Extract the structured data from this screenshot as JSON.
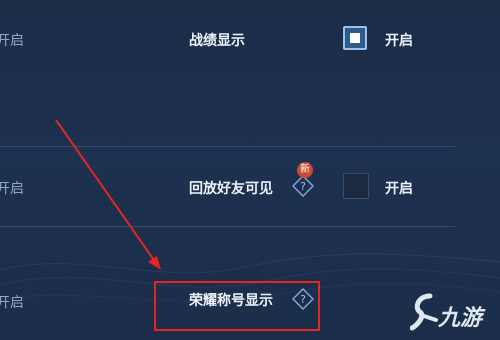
{
  "settings": {
    "rows": [
      {
        "label": "战绩显示",
        "state_label": "开启",
        "left_label": "开启"
      },
      {
        "label": "回放好友可见",
        "badge": "新",
        "state_label": "开启",
        "left_label": "开启"
      },
      {
        "label": "荣耀称号显示",
        "left_label": "开启"
      }
    ]
  },
  "watermark": {
    "text": "九游",
    "icon": "nine-game-logo"
  },
  "colors": {
    "highlight": "#e3261f",
    "checkbox_on": "#2f5a8c",
    "badge": "#c94a2e"
  }
}
